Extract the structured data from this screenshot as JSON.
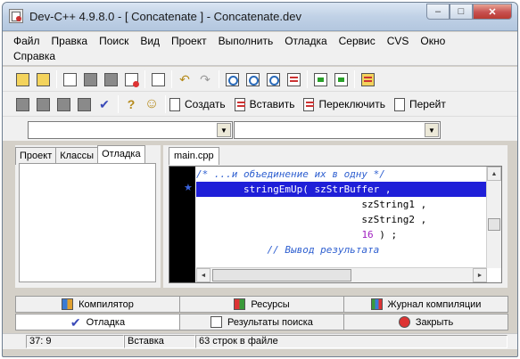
{
  "window": {
    "title": "Dev-C++ 4.9.8.0  -  [ Concatenate ] - Concatenate.dev",
    "controls": {
      "minimize": "–",
      "maximize": "□",
      "close": "✕"
    }
  },
  "menu": [
    "Файл",
    "Правка",
    "Поиск",
    "Вид",
    "Проект",
    "Выполнить",
    "Отладка",
    "Сервис",
    "CVS",
    "Окно",
    "Справка"
  ],
  "toolbar2": {
    "create_label": "Создать",
    "insert_label": "Вставить",
    "toggle_label": "Переключить",
    "goto_label": "Перейт",
    "check_glyph": "✔",
    "help_glyph": "?",
    "smile_glyph": "☺"
  },
  "left_panel": {
    "tabs": [
      "Проект",
      "Классы",
      "Отладка"
    ],
    "active_tab": "Отладка"
  },
  "editor": {
    "file_tab": "main.cpp",
    "breakpoint_marker": "★",
    "lines": [
      "/* ...и объединение их в одну */",
      "        stringEmUp( szStrBuffer ,",
      "                            szString1 ,",
      "                            szString2 ,",
      "                            16 ) ;",
      "            // Вывод результата"
    ],
    "number_literal": "16",
    "line5_rest": " ) ;"
  },
  "bottom_tabs": {
    "row1": [
      "Компилятор",
      "Ресурсы",
      "Журнал компиляции"
    ],
    "row2": [
      "Отладка",
      "Результаты поиска",
      "Закрыть"
    ],
    "active": "Отладка"
  },
  "status": {
    "position": "37: 9",
    "mode": "Вставка",
    "lines_info": "63 строк в файле"
  },
  "colors": {
    "comment": "#2e5fd0",
    "highlight": "#1f1fd8",
    "number": "#a020c0"
  }
}
